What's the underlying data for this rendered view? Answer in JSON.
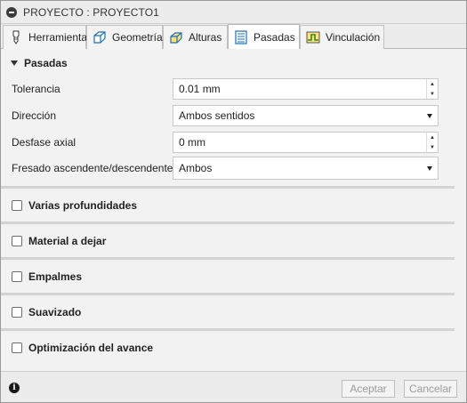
{
  "window": {
    "title": "PROYECTO : PROYECTO1"
  },
  "tabs": [
    {
      "label": "Herramienta",
      "icon": "tool-icon",
      "active": false
    },
    {
      "label": "Geometría",
      "icon": "geometry-icon",
      "active": false
    },
    {
      "label": "Alturas",
      "icon": "heights-icon",
      "active": false
    },
    {
      "label": "Pasadas",
      "icon": "passes-icon",
      "active": true
    },
    {
      "label": "Vinculación",
      "icon": "linking-icon",
      "active": false
    }
  ],
  "passes": {
    "heading": "Pasadas",
    "tolerance": {
      "label": "Tolerancia",
      "value": "0.01 mm"
    },
    "direction": {
      "label": "Dirección",
      "value": "Ambos sentidos"
    },
    "axial_offset": {
      "label": "Desfase axial",
      "value": "0 mm"
    },
    "milling": {
      "label": "Fresado ascendente/descendente",
      "value": "Ambos"
    }
  },
  "options": [
    {
      "label": "Varias profundidades",
      "checked": false
    },
    {
      "label": "Material a dejar",
      "checked": false
    },
    {
      "label": "Empalmes",
      "checked": false
    },
    {
      "label": "Suavizado",
      "checked": false
    },
    {
      "label": "Optimización del avance",
      "checked": false
    }
  ],
  "footer": {
    "info_icon": "info-icon",
    "accept_label": "Aceptar",
    "cancel_label": "Cancelar"
  }
}
